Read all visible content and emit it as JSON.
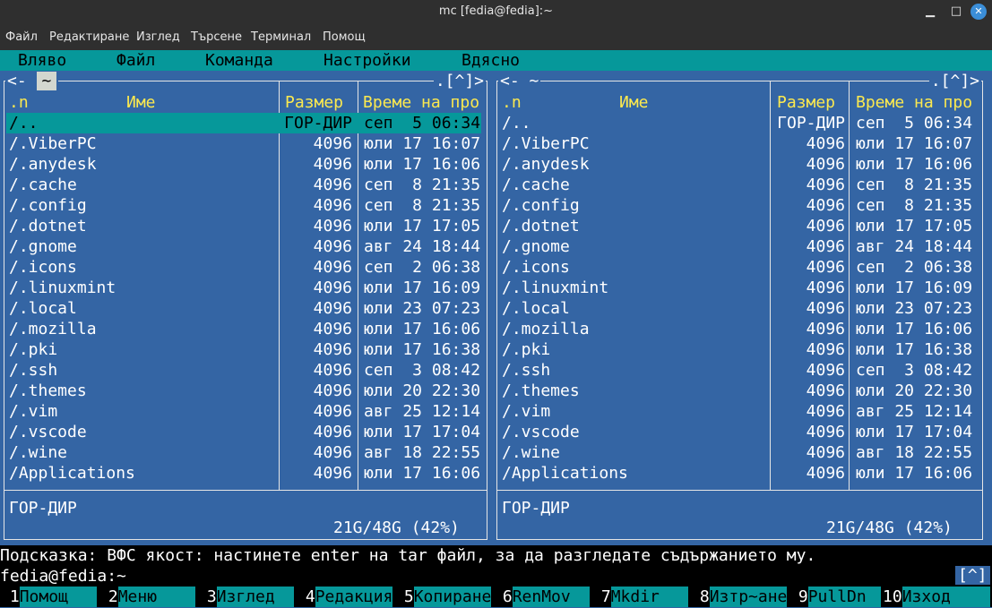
{
  "window": {
    "title": "mc [fedia@fedia]:~",
    "minimize": "▁",
    "maximize": "□",
    "close": "✕"
  },
  "terminal_menu": [
    "Файл",
    "Редактиране",
    "Изглед",
    "Търсене",
    "Терминал",
    "Помощ"
  ],
  "mc_menu": [
    "Вляво",
    "Файл",
    "Команда",
    "Настройки",
    "Вдясно"
  ],
  "left_panel": {
    "corner_left": "<-",
    "path": "~",
    "corner_right": ".[^]>",
    "headers": {
      "sort": ".n",
      "name": "Име",
      "size": "Размер",
      "time": "Време на про"
    },
    "files": [
      {
        "name": "/..",
        "size": "ГОР-ДИР",
        "time": "сеп  5 06:34"
      },
      {
        "name": "/.ViberPC",
        "size": "4096",
        "time": "юли 17 16:07"
      },
      {
        "name": "/.anydesk",
        "size": "4096",
        "time": "юли 17 16:06"
      },
      {
        "name": "/.cache",
        "size": "4096",
        "time": "сеп  8 21:35"
      },
      {
        "name": "/.config",
        "size": "4096",
        "time": "сеп  8 21:35"
      },
      {
        "name": "/.dotnet",
        "size": "4096",
        "time": "юли 17 17:05"
      },
      {
        "name": "/.gnome",
        "size": "4096",
        "time": "авг 24 18:44"
      },
      {
        "name": "/.icons",
        "size": "4096",
        "time": "сеп  2 06:38"
      },
      {
        "name": "/.linuxmint",
        "size": "4096",
        "time": "юли 17 16:09"
      },
      {
        "name": "/.local",
        "size": "4096",
        "time": "юли 23 07:23"
      },
      {
        "name": "/.mozilla",
        "size": "4096",
        "time": "юли 17 16:06"
      },
      {
        "name": "/.pki",
        "size": "4096",
        "time": "юли 17 16:38"
      },
      {
        "name": "/.ssh",
        "size": "4096",
        "time": "сеп  3 08:42"
      },
      {
        "name": "/.themes",
        "size": "4096",
        "time": "юли 20 22:30"
      },
      {
        "name": "/.vim",
        "size": "4096",
        "time": "авг 25 12:14"
      },
      {
        "name": "/.vscode",
        "size": "4096",
        "time": "юли 17 17:04"
      },
      {
        "name": "/.wine",
        "size": "4096",
        "time": "авг 18 22:55"
      },
      {
        "name": "/Applications",
        "size": "4096",
        "time": "юли 17 16:06"
      }
    ],
    "mini_status": "ГОР-ДИР",
    "free_space": "21G/48G (42%)"
  },
  "right_panel": {
    "corner_left": "<-",
    "path": "~",
    "corner_right": ".[^]>",
    "headers": {
      "sort": ".n",
      "name": "Име",
      "size": "Размер",
      "time": "Време на про"
    },
    "files": [
      {
        "name": "/..",
        "size": "ГОР-ДИР",
        "time": "сеп  5 06:34"
      },
      {
        "name": "/.ViberPC",
        "size": "4096",
        "time": "юли 17 16:07"
      },
      {
        "name": "/.anydesk",
        "size": "4096",
        "time": "юли 17 16:06"
      },
      {
        "name": "/.cache",
        "size": "4096",
        "time": "сеп  8 21:35"
      },
      {
        "name": "/.config",
        "size": "4096",
        "time": "сеп  8 21:35"
      },
      {
        "name": "/.dotnet",
        "size": "4096",
        "time": "юли 17 17:05"
      },
      {
        "name": "/.gnome",
        "size": "4096",
        "time": "авг 24 18:44"
      },
      {
        "name": "/.icons",
        "size": "4096",
        "time": "сеп  2 06:38"
      },
      {
        "name": "/.linuxmint",
        "size": "4096",
        "time": "юли 17 16:09"
      },
      {
        "name": "/.local",
        "size": "4096",
        "time": "юли 23 07:23"
      },
      {
        "name": "/.mozilla",
        "size": "4096",
        "time": "юли 17 16:06"
      },
      {
        "name": "/.pki",
        "size": "4096",
        "time": "юли 17 16:38"
      },
      {
        "name": "/.ssh",
        "size": "4096",
        "time": "сеп  3 08:42"
      },
      {
        "name": "/.themes",
        "size": "4096",
        "time": "юли 20 22:30"
      },
      {
        "name": "/.vim",
        "size": "4096",
        "time": "авг 25 12:14"
      },
      {
        "name": "/.vscode",
        "size": "4096",
        "time": "юли 17 17:04"
      },
      {
        "name": "/.wine",
        "size": "4096",
        "time": "авг 18 22:55"
      },
      {
        "name": "/Applications",
        "size": "4096",
        "time": "юли 17 16:06"
      }
    ],
    "mini_status": "ГОР-ДИР",
    "free_space": "21G/48G (42%)"
  },
  "hint": "Подсказка: ВФС якост: настинете enter на tar файл, за да разгледате съдържанието му.",
  "command_line": "fedia@fedia:~",
  "history_button": "[^]",
  "function_keys": [
    {
      "num": "1",
      "label": "Помощ"
    },
    {
      "num": "2",
      "label": "Меню"
    },
    {
      "num": "3",
      "label": "Изглед"
    },
    {
      "num": "4",
      "label": "Редакция"
    },
    {
      "num": "5",
      "label": "Копиране"
    },
    {
      "num": "6",
      "label": "RenMov"
    },
    {
      "num": "7",
      "label": "Mkdir"
    },
    {
      "num": "8",
      "label": "Изтр~ане"
    },
    {
      "num": "9",
      "label": "PullDn"
    },
    {
      "num": "10",
      "label": "Изход"
    }
  ],
  "colors": {
    "panel_bg": "#3465a4",
    "highlight": "#06989a",
    "header_yellow": "#fce94f"
  }
}
